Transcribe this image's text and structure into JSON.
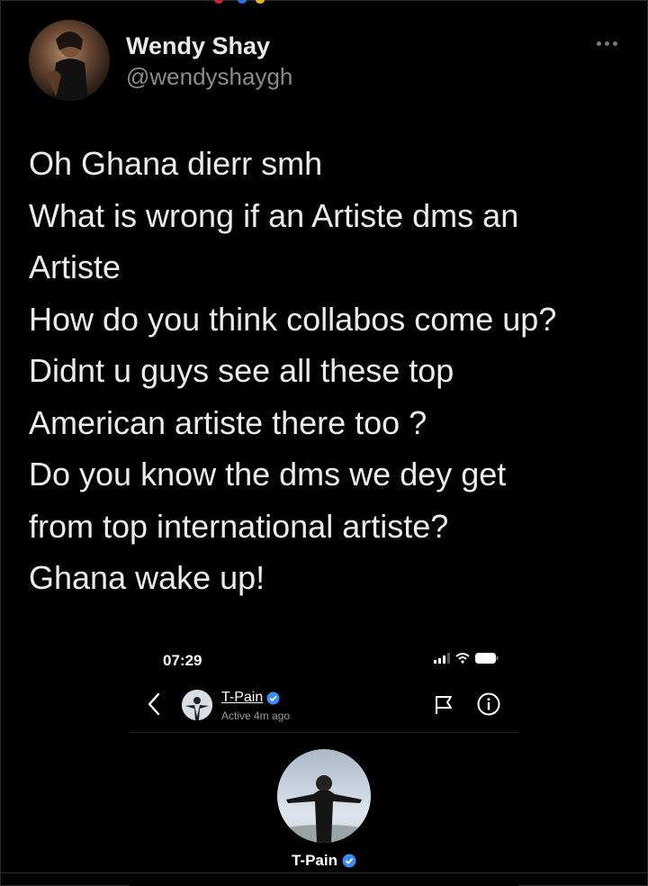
{
  "tweet": {
    "author_name": "Wendy Shay",
    "author_handle": "@wendyshaygh",
    "lines": [
      "Oh Ghana dierr smh",
      "What is wrong if an Artiste dms an",
      "Artiste",
      "How do you think collabos come up?",
      "Didnt u guys see all these top",
      "American artiste there too ?",
      "Do you know the dms we dey get",
      "from top international artiste?",
      "Ghana wake up!"
    ]
  },
  "screenshot": {
    "time": "07:29",
    "contact_name": "T-Pain",
    "active_status": "Active 4m ago",
    "profile_name": "T-Pain"
  },
  "colors": {
    "background": "#000000",
    "verified_badge": "#3b8df0",
    "secondary_text": "#8b8b8b"
  },
  "icons": [
    "more-options-icon",
    "back-chevron-icon",
    "flag-icon",
    "info-icon",
    "verified-icon",
    "signal-icon",
    "wifi-icon",
    "battery-icon"
  ]
}
